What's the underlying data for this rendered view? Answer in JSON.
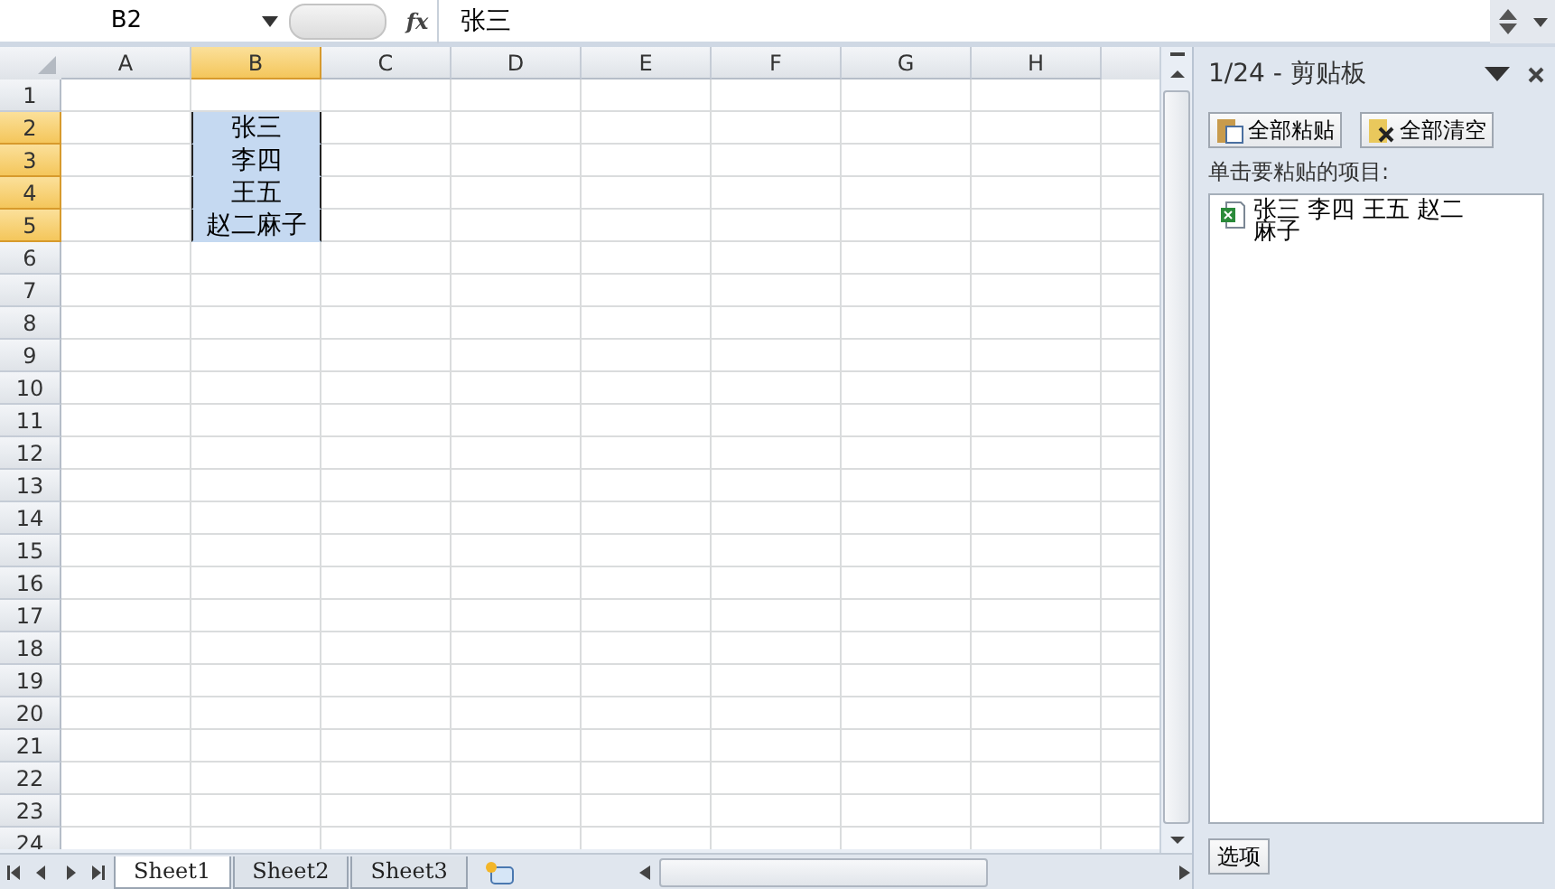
{
  "name_box": "B2",
  "fx_label": "fx",
  "formula": "张三",
  "columns": [
    {
      "label": "A",
      "selected": false
    },
    {
      "label": "B",
      "selected": true
    },
    {
      "label": "C",
      "selected": false
    },
    {
      "label": "D",
      "selected": false
    },
    {
      "label": "E",
      "selected": false
    },
    {
      "label": "F",
      "selected": false
    },
    {
      "label": "G",
      "selected": false
    },
    {
      "label": "H",
      "selected": false
    }
  ],
  "rows": [
    {
      "label": "1",
      "selected": false,
      "cells": []
    },
    {
      "label": "2",
      "selected": true,
      "cells": [
        null,
        {
          "text": "张三",
          "selected": true
        }
      ]
    },
    {
      "label": "3",
      "selected": true,
      "cells": [
        null,
        {
          "text": "李四",
          "selected": true
        }
      ]
    },
    {
      "label": "4",
      "selected": true,
      "cells": [
        null,
        {
          "text": "王五",
          "selected": true
        }
      ]
    },
    {
      "label": "5",
      "selected": true,
      "cells": [
        null,
        {
          "text": "赵二麻子",
          "selected": true
        }
      ]
    },
    {
      "label": "6",
      "selected": false,
      "cells": []
    },
    {
      "label": "7",
      "selected": false,
      "cells": []
    },
    {
      "label": "8",
      "selected": false,
      "cells": []
    },
    {
      "label": "9",
      "selected": false,
      "cells": []
    },
    {
      "label": "10",
      "selected": false,
      "cells": []
    },
    {
      "label": "11",
      "selected": false,
      "cells": []
    },
    {
      "label": "12",
      "selected": false,
      "cells": []
    },
    {
      "label": "13",
      "selected": false,
      "cells": []
    },
    {
      "label": "14",
      "selected": false,
      "cells": []
    },
    {
      "label": "15",
      "selected": false,
      "cells": []
    },
    {
      "label": "16",
      "selected": false,
      "cells": []
    },
    {
      "label": "17",
      "selected": false,
      "cells": []
    },
    {
      "label": "18",
      "selected": false,
      "cells": []
    },
    {
      "label": "19",
      "selected": false,
      "cells": []
    },
    {
      "label": "20",
      "selected": false,
      "cells": []
    },
    {
      "label": "21",
      "selected": false,
      "cells": []
    },
    {
      "label": "22",
      "selected": false,
      "cells": []
    },
    {
      "label": "23",
      "selected": false,
      "cells": []
    },
    {
      "label": "24",
      "selected": false,
      "cells": []
    }
  ],
  "sheet_tabs": [
    {
      "label": "Sheet1",
      "selected": true
    },
    {
      "label": "Sheet2",
      "selected": false
    },
    {
      "label": "Sheet3",
      "selected": false
    }
  ],
  "clipboard": {
    "title": "1/24 - 剪贴板",
    "paste_all": "全部粘贴",
    "clear_all": "全部清空",
    "hint": "单击要粘贴的项目:",
    "items": [
      {
        "text": "张三  李四  王五  赵二麻子"
      }
    ],
    "options": "选项"
  }
}
